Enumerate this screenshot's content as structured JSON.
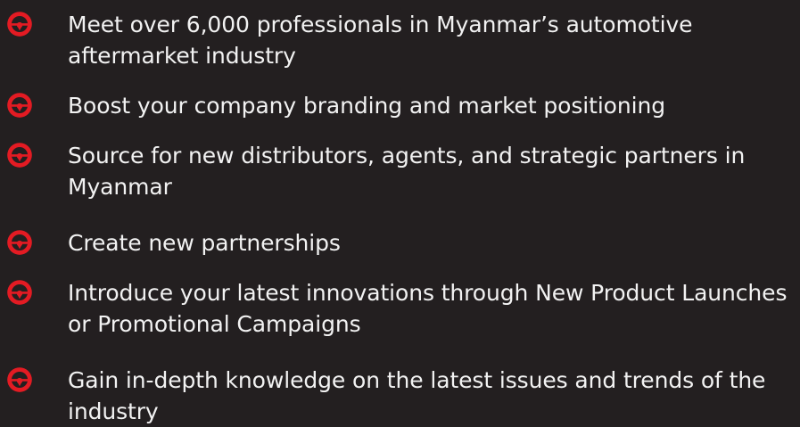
{
  "accent_color": "#e31b23",
  "icon_name": "steering-wheel-icon",
  "benefits": [
    {
      "text": "Meet over 6,000 professionals in Myanmar’s automotive aftermarket industry"
    },
    {
      "text": "Boost your company branding and market positioning"
    },
    {
      "text": "Source for new distributors, agents, and strategic partners in Myanmar"
    },
    {
      "text": "Create new partnerships"
    },
    {
      "text": "Introduce your latest innovations through New Product Launches or Promotional Campaigns"
    },
    {
      "text": "Gain in-depth knowledge on the latest issues and trends of the industry"
    }
  ]
}
